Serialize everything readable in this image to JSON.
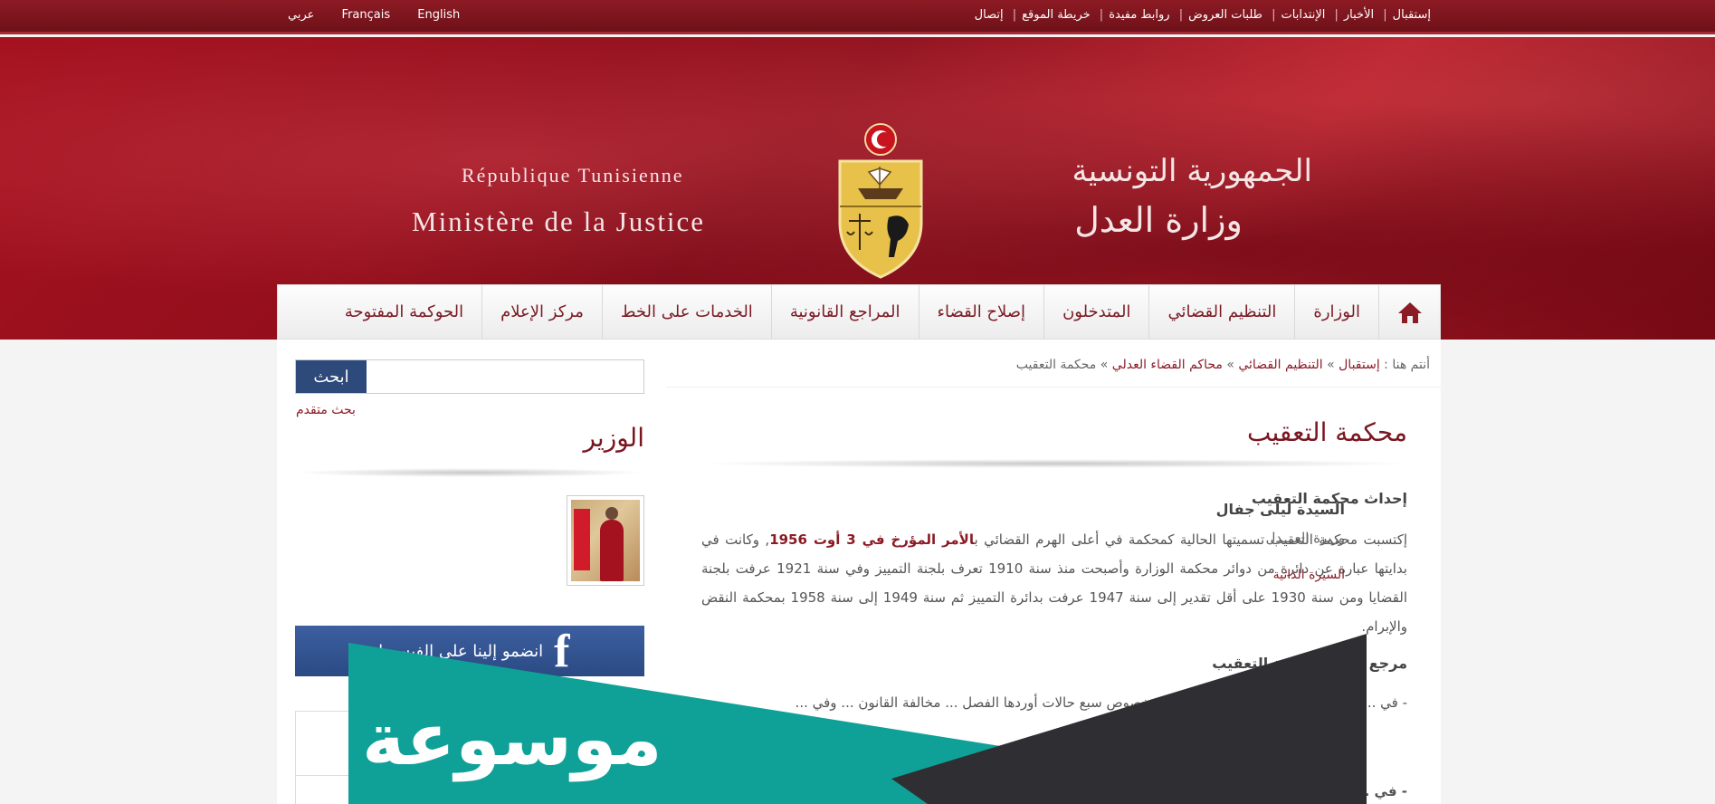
{
  "top_nav": {
    "links": [
      "إستقبال",
      "الأخبار",
      "الإنتدابات",
      "طلبات العروض",
      "روابط مفيدة",
      "خريطة الموقع",
      "إتصال"
    ]
  },
  "languages": [
    "English",
    "Français",
    "عربي"
  ],
  "banner": {
    "fr_line1": "République Tunisienne",
    "fr_line2": "Ministère de la Justice",
    "ar_line1": "الجمهورية التونسية",
    "ar_line2": "وزارة العدل"
  },
  "main_nav": {
    "items": [
      "الوزارة",
      "التنظيم القضائي",
      "المتدخلون",
      "إصلاح القضاء",
      "المراجع القانونية",
      "الخدمات على الخط",
      "مركز الإعلام",
      "الحوكمة المفتوحة"
    ]
  },
  "breadcrumb": {
    "prefix": "أنتم هنا :",
    "items": [
      "إستقبال",
      "التنظيم القضائي",
      "محاكم القضاء العدلي"
    ],
    "current": "محكمة التعقيب"
  },
  "article": {
    "title": "محكمة التعقيب",
    "section1_heading": "إحداث محكمة التعقيب",
    "section1_text_a": "إكتسبت محكمة التعقيب تسميتها الحالية كمحكمة في أعلى الهرم القضائي ب",
    "section1_text_bold": "الأمر المؤرخ في 3 أوت 1956",
    "section1_text_b": ", وكانت في بدايتها عبارة عن دائرة من دوائر محكمة الوزارة وأصبحت منذ سنة 1910 تعرف بلجنة التمييز وفي سنة 1921 عرفت بلجنة القضايا ومن سنة 1930 على أقل تقدير إلى سنة 1947 عرفت بدائرة التمييز ثم سنة 1949 إلى سنة 1958 بمحكمة النقض والإبرام.",
    "section2_heading": "مرجع النظر محكمة التعقيب",
    "section2_text": "- في ... في الأحكام النهائية الدرجة, وذلك في خصوص سبع حالات أوردها الفصل ... مخالفة القانون ... وفي ...",
    "section3_start": "- في ..."
  },
  "sidebar": {
    "search_button": "ابحث",
    "search_placeholder": "",
    "advanced_search": "بحث متقدم",
    "minister_heading": "الوزير",
    "minister_name": "السيدة ليلى جفال",
    "minister_role": "وزيرة العـــدل",
    "minister_cv": "السيرة الذاتية",
    "facebook_label": "انضمو إلينا على الفيسبوك"
  },
  "watermark": {
    "text": "موسوعة",
    "colors": {
      "teal": "#0fa197",
      "dark": "#2f2f33"
    }
  },
  "colors": {
    "brand_red": "#8b1b25",
    "nav_text": "#7b1b24",
    "search_blue": "#2d4a7a",
    "facebook_blue": "#3b5998"
  }
}
